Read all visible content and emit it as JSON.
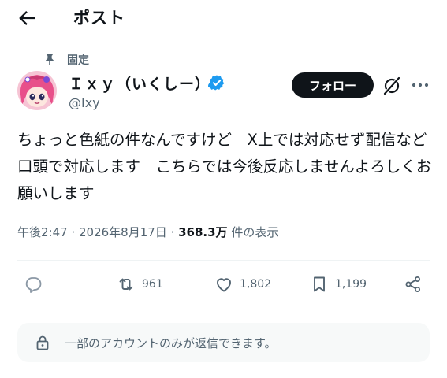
{
  "header": {
    "title": "ポスト",
    "back_icon": "arrow-left-icon"
  },
  "post": {
    "pinned_label": "固定",
    "author": {
      "display_name": "Ｉｘｙ（いくしー）",
      "handle": "@Ixy",
      "verified": true,
      "verified_color": "#1d9bf0"
    },
    "follow_label": "フォロー",
    "text": "ちょっと色紙の件なんですけど　X上では対応せず配信など口頭で対応します　こちらでは今後反応しませんよろしくお願いします",
    "timestamp": "午後2:47 · 2026年8月17日 · ",
    "views": "368.3万",
    "views_label": " 件の表示"
  },
  "actions": {
    "reply": {
      "icon": "reply-icon"
    },
    "repost": {
      "icon": "repost-icon",
      "count": "961"
    },
    "like": {
      "icon": "heart-icon",
      "count": "1,802"
    },
    "bookmark": {
      "icon": "bookmark-icon",
      "count": "1,199"
    },
    "share": {
      "icon": "share-icon"
    }
  },
  "notice": {
    "text": "一部のアカウントのみが返信できます。",
    "icon": "lock-icon"
  },
  "colors": {
    "text_primary": "#0f1419",
    "text_secondary": "#536471",
    "accent": "#1d9bf0",
    "notice_bg": "#f7f9f9"
  }
}
